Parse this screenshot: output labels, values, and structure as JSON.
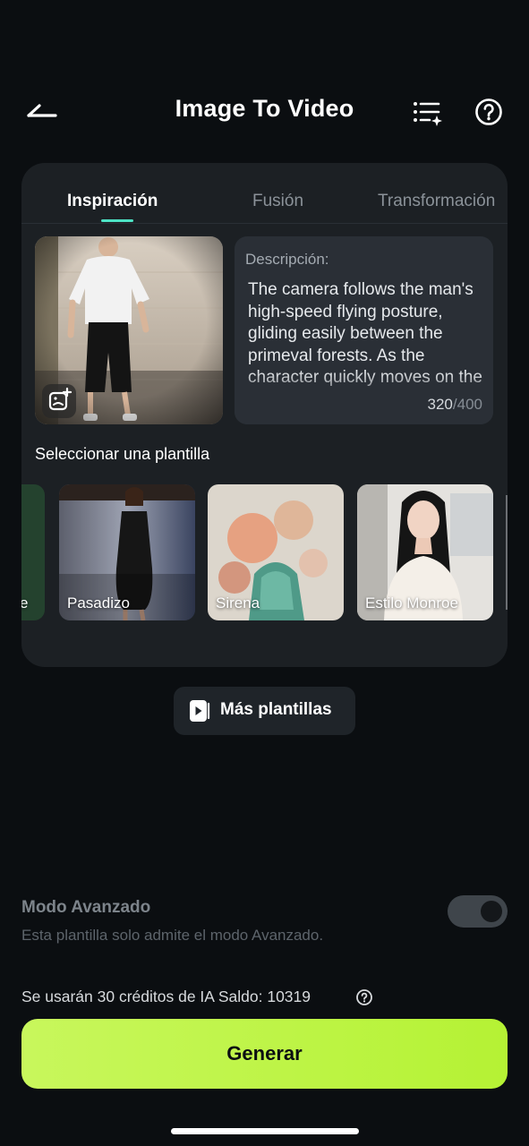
{
  "header": {
    "title": "Image To Video",
    "back_icon": "back-arrow-icon",
    "list_icon": "list-sparkle-icon",
    "help_icon": "question-circle-icon"
  },
  "tabs": [
    {
      "label": "Inspiración",
      "active": true
    },
    {
      "label": "Fusión",
      "active": false
    },
    {
      "label": "Transformación",
      "active": false
    }
  ],
  "description": {
    "label": "Descripción:",
    "text": "The camera follows the man's high-speed flying posture, gliding easily between the primeval forests. As the character quickly moves on the",
    "count_used": "320",
    "count_sep": "/",
    "count_max": "400"
  },
  "templates": {
    "heading": "Seleccionar una plantilla",
    "items": [
      {
        "label": "e"
      },
      {
        "label": "Pasadizo"
      },
      {
        "label": "Sirena"
      },
      {
        "label": "Estilo Monroe"
      }
    ]
  },
  "more_templates": {
    "label": "Más plantillas"
  },
  "advanced": {
    "title": "Modo Avanzado",
    "subtitle": "Esta plantilla solo admite el modo Avanzado.",
    "enabled": true
  },
  "credits": {
    "text": "Se usarán 30 créditos de IA Saldo: 10319"
  },
  "generate": {
    "label": "Generar"
  },
  "colors": {
    "accent": "#b9f43c",
    "tab_indicator": "#4de2c4",
    "background": "#0b0e11",
    "card": "#1c2024"
  }
}
